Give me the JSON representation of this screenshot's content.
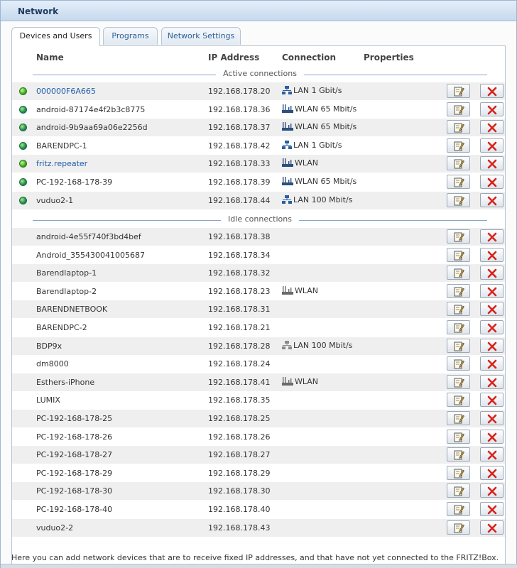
{
  "window": {
    "title": "Network"
  },
  "tabs": [
    {
      "label": "Devices and Users",
      "active": true
    },
    {
      "label": "Programs",
      "active": false
    },
    {
      "label": "Network Settings",
      "active": false
    }
  ],
  "columns": {
    "name": "Name",
    "ip": "IP Address",
    "connection": "Connection",
    "properties": "Properties"
  },
  "sections": {
    "active": "Active connections",
    "idle": "Idle connections"
  },
  "active": [
    {
      "name": "000000F6A665",
      "ip": "192.168.178.20",
      "conn": "LAN 1 Gbit/s",
      "conn_icon": "lan-icon",
      "status_icon": "online-dot-icon",
      "link": true
    },
    {
      "name": "android-87174e4f2b3c8775",
      "ip": "192.168.178.36",
      "conn": "WLAN 65 Mbit/s",
      "conn_icon": "wlan-icon",
      "status_icon": "internet-globe-icon",
      "link": false
    },
    {
      "name": "android-9b9aa69a06e2256d",
      "ip": "192.168.178.37",
      "conn": "WLAN 65 Mbit/s",
      "conn_icon": "wlan-icon",
      "status_icon": "internet-globe-icon",
      "link": false
    },
    {
      "name": "BARENDPC-1",
      "ip": "192.168.178.42",
      "conn": "LAN 1 Gbit/s",
      "conn_icon": "lan-icon",
      "status_icon": "internet-globe-icon",
      "link": false
    },
    {
      "name": "fritz.repeater",
      "ip": "192.168.178.33",
      "conn": "WLAN",
      "conn_icon": "wlan-icon",
      "status_icon": "online-dot-icon",
      "link": true
    },
    {
      "name": "PC-192-168-178-39",
      "ip": "192.168.178.39",
      "conn": "WLAN 65 Mbit/s",
      "conn_icon": "wlan-icon",
      "status_icon": "internet-globe-icon",
      "link": false
    },
    {
      "name": "vuduo2-1",
      "ip": "192.168.178.44",
      "conn": "LAN 100 Mbit/s",
      "conn_icon": "lan-icon",
      "status_icon": "internet-globe-icon",
      "link": false
    }
  ],
  "idle": [
    {
      "name": "android-4e55f740f3bd4bef",
      "ip": "192.168.178.38",
      "conn": "",
      "conn_icon": ""
    },
    {
      "name": "Android_355430041005687",
      "ip": "192.168.178.34",
      "conn": "",
      "conn_icon": ""
    },
    {
      "name": "Barendlaptop-1",
      "ip": "192.168.178.32",
      "conn": "",
      "conn_icon": ""
    },
    {
      "name": "Barendlaptop-2",
      "ip": "192.168.178.23",
      "conn": "WLAN",
      "conn_icon": "wlan-icon-grey"
    },
    {
      "name": "BARENDNETBOOK",
      "ip": "192.168.178.31",
      "conn": "",
      "conn_icon": ""
    },
    {
      "name": "BARENDPC-2",
      "ip": "192.168.178.21",
      "conn": "",
      "conn_icon": ""
    },
    {
      "name": "BDP9x",
      "ip": "192.168.178.28",
      "conn": "LAN 100 Mbit/s",
      "conn_icon": "lan-icon-grey"
    },
    {
      "name": "dm8000",
      "ip": "192.168.178.24",
      "conn": "",
      "conn_icon": ""
    },
    {
      "name": "Esthers-iPhone",
      "ip": "192.168.178.41",
      "conn": "WLAN",
      "conn_icon": "wlan-icon-grey"
    },
    {
      "name": "LUMIX",
      "ip": "192.168.178.35",
      "conn": "",
      "conn_icon": ""
    },
    {
      "name": "PC-192-168-178-25",
      "ip": "192.168.178.25",
      "conn": "",
      "conn_icon": ""
    },
    {
      "name": "PC-192-168-178-26",
      "ip": "192.168.178.26",
      "conn": "",
      "conn_icon": ""
    },
    {
      "name": "PC-192-168-178-27",
      "ip": "192.168.178.27",
      "conn": "",
      "conn_icon": ""
    },
    {
      "name": "PC-192-168-178-29",
      "ip": "192.168.178.29",
      "conn": "",
      "conn_icon": ""
    },
    {
      "name": "PC-192-168-178-30",
      "ip": "192.168.178.30",
      "conn": "",
      "conn_icon": ""
    },
    {
      "name": "PC-192-168-178-40",
      "ip": "192.168.178.40",
      "conn": "",
      "conn_icon": ""
    },
    {
      "name": "vuduo2-2",
      "ip": "192.168.178.43",
      "conn": "",
      "conn_icon": ""
    }
  ],
  "row_actions": {
    "edit_icon": "edit-icon",
    "delete_icon": "delete-x-icon"
  },
  "footer": {
    "text": "Here you can add network devices that are to receive fixed IP addresses, and that have not yet connected to the FRITZ!Box."
  },
  "colors": {
    "link": "#1f5ea8",
    "delete": "#d8231b",
    "row_alt": "#efefef",
    "accent_border": "#9db6d2"
  }
}
